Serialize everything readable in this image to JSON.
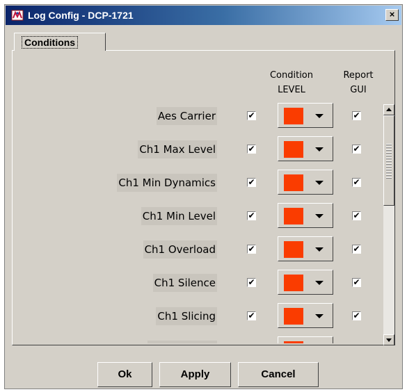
{
  "window": {
    "title": "Log Config - DCP-1721",
    "close_glyph": "×"
  },
  "tabs": [
    {
      "label": "Conditions",
      "selected": true
    }
  ],
  "columns": {
    "level_line1": "Condition",
    "level_line2": "LEVEL",
    "gui_line1": "Report",
    "gui_line2": "GUI"
  },
  "colors": {
    "severity": "#fa3c00"
  },
  "conditions": [
    {
      "label": "Aes Carrier",
      "log_check": "✔",
      "level_color": "#fa3c00",
      "gui_check": "✔"
    },
    {
      "label": "Ch1 Max Level",
      "log_check": "✔",
      "level_color": "#fa3c00",
      "gui_check": "✔"
    },
    {
      "label": "Ch1 Min Dynamics",
      "log_check": "✔",
      "level_color": "#fa3c00",
      "gui_check": "✔"
    },
    {
      "label": "Ch1 Min Level",
      "log_check": "✔",
      "level_color": "#fa3c00",
      "gui_check": "✔"
    },
    {
      "label": "Ch1 Overload",
      "log_check": "✔",
      "level_color": "#fa3c00",
      "gui_check": "✔"
    },
    {
      "label": "Ch1 Silence",
      "log_check": "✔",
      "level_color": "#fa3c00",
      "gui_check": "✔"
    },
    {
      "label": "Ch1 Slicing",
      "log_check": "✔",
      "level_color": "#fa3c00",
      "gui_check": "✔"
    },
    {
      "label": "",
      "log_check": "",
      "level_color": "#fa3c00",
      "gui_check": ""
    }
  ],
  "buttons": {
    "ok": "Ok",
    "apply": "Apply",
    "cancel": "Cancel"
  }
}
